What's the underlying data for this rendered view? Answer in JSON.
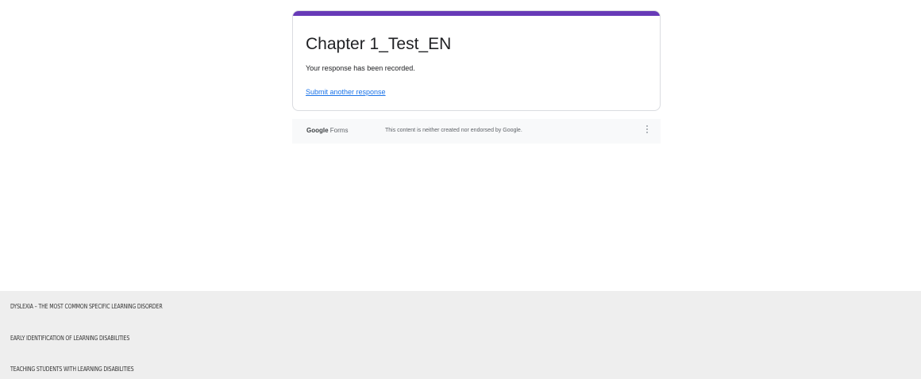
{
  "form": {
    "title": "Chapter 1_Test_EN",
    "message": "Your response has been recorded.",
    "link_label": "Submit another response",
    "accent_color": "#673ab7"
  },
  "forms_footer": {
    "brand_google": "Google",
    "brand_forms": " Forms",
    "note": "This content is neither created nor endorsed by Google.",
    "menu_icon": "more-vert-icon"
  },
  "bottom_links": [
    {
      "label": "DYSLEXIA – THE MOST COMMON SPECIFIC LEARNING DISORDER"
    },
    {
      "label": "EARLY IDENTIFICATION OF LEARNING DISABILITIES"
    },
    {
      "label": "TEACHING STUDENTS WITH LEARNING DISABILITIES"
    }
  ]
}
